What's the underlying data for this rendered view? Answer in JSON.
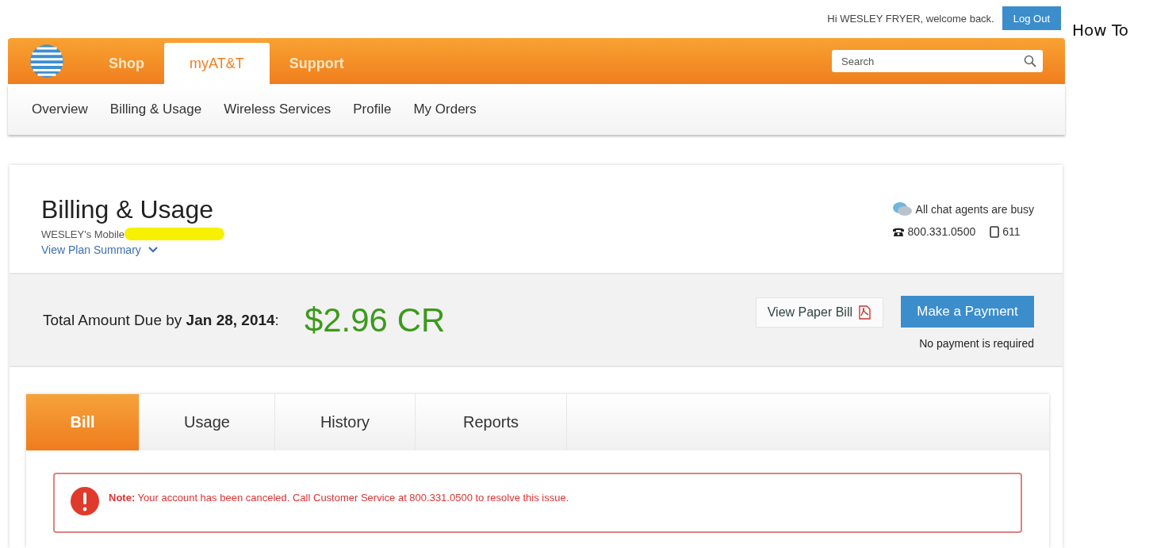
{
  "header": {
    "greeting": "Hi WESLEY FRYER, welcome back.",
    "logout": "Log Out",
    "side_link": "How To"
  },
  "main_tabs": [
    {
      "label": "Shop",
      "selected": false
    },
    {
      "label": "myAT&T",
      "selected": true
    },
    {
      "label": "Support",
      "selected": false
    }
  ],
  "search": {
    "placeholder": "Search"
  },
  "sub_nav": [
    "Overview",
    "Billing & Usage",
    "Wireless Services",
    "Profile",
    "My Orders"
  ],
  "page": {
    "title": "Billing & Usage",
    "account": "WESLEY's Mobile",
    "plan_link": "View Plan Summary",
    "chat_status": "All chat agents are busy",
    "phone": "800.331.0500",
    "mobile": "611"
  },
  "amount": {
    "label": "Total Amount Due by **Jan 28, 2014**:",
    "value": "$2.96 CR",
    "paper_bill": "View Paper Bill",
    "pay": "Make a Payment",
    "pay_note": "No payment is required"
  },
  "bill_tabs": [
    {
      "label": "Bill",
      "selected": true
    },
    {
      "label": "Usage",
      "selected": false
    },
    {
      "label": "History",
      "selected": false
    },
    {
      "label": "Reports",
      "selected": false
    }
  ],
  "alert": {
    "text": "**Note:** Your account has been canceled. Call Customer Service at 800.331.0500 to resolve this issue."
  }
}
